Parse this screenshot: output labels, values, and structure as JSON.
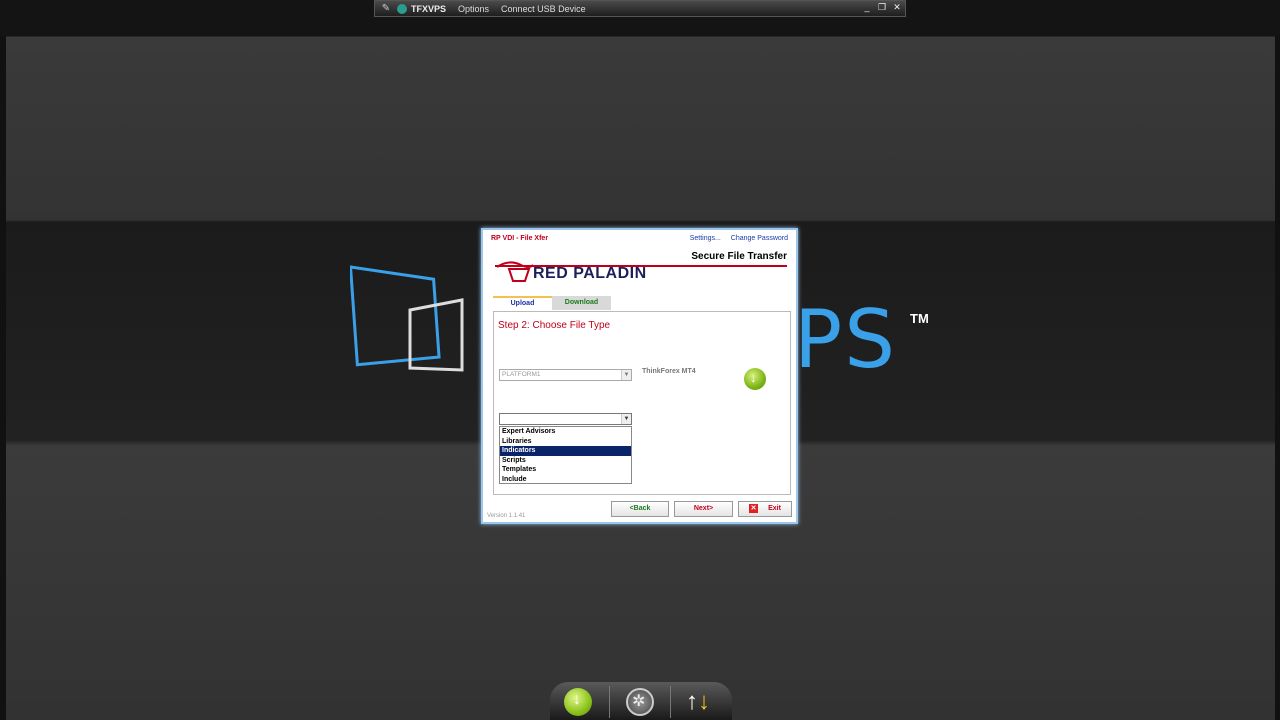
{
  "topbar": {
    "brand": "TFXVPS",
    "options": "Options",
    "connect_usb": "Connect USB Device",
    "minimize": "_",
    "restore": "❐",
    "close": "✕"
  },
  "background": {
    "logo_text": "PS",
    "trademark": "TM"
  },
  "dialog": {
    "title": "RP VDI - File Xfer",
    "settings_link": "Settings...",
    "change_password_link": "Change Password",
    "header": "Secure File Transfer",
    "brand_name": "RED PALADIN",
    "tabs": [
      {
        "label": "Upload",
        "active": true
      },
      {
        "label": "Download",
        "active": false
      }
    ],
    "step_title": "Step 2: Choose File Type",
    "platform_combo_value": "PLATFORM1",
    "platform_info": "ThinkForex MT4",
    "file_type_combo_value": "",
    "file_type_options": [
      "Expert Advisors",
      "Libraries",
      "Indicators",
      "Scripts",
      "Templates",
      "Include"
    ],
    "selected_option": "Indicators",
    "version": "Version 1.1.41",
    "back_label": "<Back",
    "next_label": "Next>",
    "exit_label": "Exit",
    "colors": {
      "accent_red": "#c0001a",
      "selection": "#0a246a",
      "link_blue": "#1a3aa8"
    }
  },
  "dock": {
    "icons": [
      "download-icon",
      "settings-dial-icon",
      "transfer-arrows-icon"
    ]
  }
}
